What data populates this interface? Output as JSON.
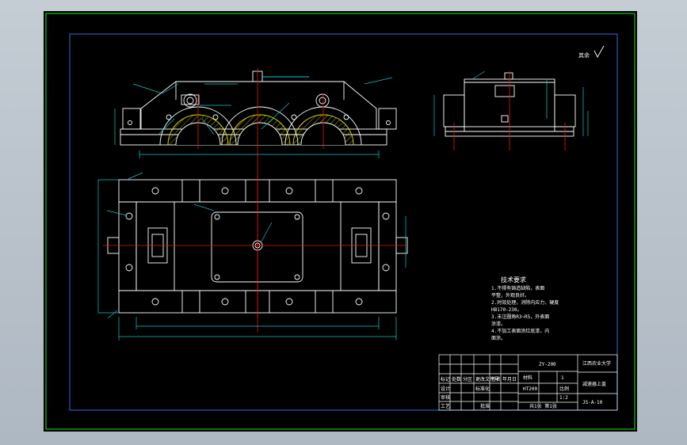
{
  "drawing": {
    "roughness_note": "其余",
    "technical_requirements": {
      "title": "技术要求",
      "lines": [
        "1.不得有铸造缺陷，表面",
        "  平整，外观良好。",
        "2.时效处理，消除内应力，硬度",
        "  HB170-230。",
        "3.未注圆角R3~R5，外表面",
        "  涂漆。",
        "4.不加工表面涂红底漆，内",
        "  面涂。"
      ]
    },
    "title_block": {
      "school": "江西农业大学",
      "part_name": "减速器上盖",
      "code": "ZY-200",
      "material": "HT200",
      "material_label": "材料",
      "scale": "1:2",
      "scale_label": "比例",
      "quantity": "1",
      "drawing_no": "JS-A-10",
      "sheet_info": "共1张 第1张",
      "col_labels": [
        "标记",
        "处数",
        "分区",
        "更改文件号",
        "签名",
        "年月日"
      ],
      "row_labels": [
        "设计",
        "审核",
        "工艺"
      ],
      "approve_label": "批准",
      "standardize_label": "标准化"
    }
  },
  "colors": {
    "background": "#000000",
    "outer_frame": "#18c318",
    "inner_frame": "#2a6fd6",
    "outline": "#ffffff",
    "centerline": "#e01818",
    "dimension": "#10c8c8",
    "hatch": "#e8e800",
    "text": "#ffffff"
  }
}
